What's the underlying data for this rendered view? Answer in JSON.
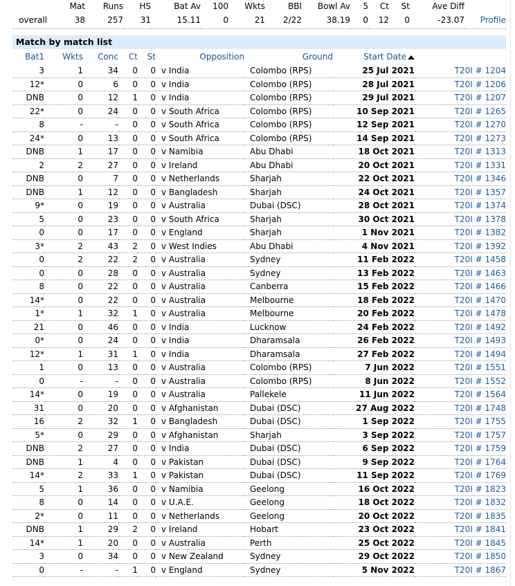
{
  "summary": {
    "headers": [
      "",
      "Mat",
      "Runs",
      "HS",
      "Bat Av",
      "100",
      "Wkts",
      "BBI",
      "Bowl Av",
      "5",
      "Ct",
      "St",
      "Ave Diff",
      ""
    ],
    "row": [
      "overall",
      "38",
      "257",
      "31",
      "15.11",
      "0",
      "21",
      "2/22",
      "38.19",
      "0",
      "12",
      "0",
      "-23.07",
      "Profile"
    ]
  },
  "section_title": "Match by match list",
  "columns": [
    "Bat1",
    "Wkts",
    "Conc",
    "Ct",
    "St",
    "Opposition",
    "Ground",
    "Start Date",
    ""
  ],
  "sort_indicator": "ascending",
  "rows": [
    [
      "3",
      "1",
      "34",
      "0",
      "0",
      "v India",
      "Colombo (RPS)",
      "25 Jul 2021",
      "T20I # 1204"
    ],
    [
      "12*",
      "0",
      "6",
      "0",
      "0",
      "v India",
      "Colombo (RPS)",
      "28 Jul 2021",
      "T20I # 1206"
    ],
    [
      "DNB",
      "0",
      "12",
      "1",
      "0",
      "v India",
      "Colombo (RPS)",
      "29 Jul 2021",
      "T20I # 1207"
    ],
    [
      "22*",
      "0",
      "24",
      "0",
      "0",
      "v South Africa",
      "Colombo (RPS)",
      "10 Sep 2021",
      "T20I # 1265"
    ],
    [
      "8",
      "-",
      "-",
      "0",
      "0",
      "v South Africa",
      "Colombo (RPS)",
      "12 Sep 2021",
      "T20I # 1270"
    ],
    [
      "24*",
      "0",
      "13",
      "0",
      "0",
      "v South Africa",
      "Colombo (RPS)",
      "14 Sep 2021",
      "T20I # 1273"
    ],
    [
      "DNB",
      "1",
      "17",
      "0",
      "0",
      "v Namibia",
      "Abu Dhabi",
      "18 Oct 2021",
      "T20I # 1313"
    ],
    [
      "2",
      "2",
      "27",
      "0",
      "0",
      "v Ireland",
      "Abu Dhabi",
      "20 Oct 2021",
      "T20I # 1331"
    ],
    [
      "DNB",
      "0",
      "7",
      "0",
      "0",
      "v Netherlands",
      "Sharjah",
      "22 Oct 2021",
      "T20I # 1346"
    ],
    [
      "DNB",
      "1",
      "12",
      "0",
      "0",
      "v Bangladesh",
      "Sharjah",
      "24 Oct 2021",
      "T20I # 1357"
    ],
    [
      "9*",
      "0",
      "19",
      "0",
      "0",
      "v Australia",
      "Dubai (DSC)",
      "28 Oct 2021",
      "T20I # 1374"
    ],
    [
      "5",
      "0",
      "23",
      "0",
      "0",
      "v South Africa",
      "Sharjah",
      "30 Oct 2021",
      "T20I # 1378"
    ],
    [
      "0",
      "0",
      "17",
      "0",
      "0",
      "v England",
      "Sharjah",
      "1 Nov 2021",
      "T20I # 1382"
    ],
    [
      "3*",
      "2",
      "43",
      "2",
      "0",
      "v West Indies",
      "Abu Dhabi",
      "4 Nov 2021",
      "T20I # 1392"
    ],
    [
      "0",
      "2",
      "22",
      "2",
      "0",
      "v Australia",
      "Sydney",
      "11 Feb 2022",
      "T20I # 1458"
    ],
    [
      "0",
      "0",
      "28",
      "0",
      "0",
      "v Australia",
      "Sydney",
      "13 Feb 2022",
      "T20I # 1463"
    ],
    [
      "8",
      "0",
      "22",
      "0",
      "0",
      "v Australia",
      "Canberra",
      "15 Feb 2022",
      "T20I # 1466"
    ],
    [
      "14*",
      "0",
      "22",
      "0",
      "0",
      "v Australia",
      "Melbourne",
      "18 Feb 2022",
      "T20I # 1470"
    ],
    [
      "1*",
      "1",
      "32",
      "1",
      "0",
      "v Australia",
      "Melbourne",
      "20 Feb 2022",
      "T20I # 1478"
    ],
    [
      "21",
      "0",
      "46",
      "0",
      "0",
      "v India",
      "Lucknow",
      "24 Feb 2022",
      "T20I # 1492"
    ],
    [
      "0*",
      "0",
      "24",
      "0",
      "0",
      "v India",
      "Dharamsala",
      "26 Feb 2022",
      "T20I # 1493"
    ],
    [
      "12*",
      "1",
      "31",
      "1",
      "0",
      "v India",
      "Dharamsala",
      "27 Feb 2022",
      "T20I # 1494"
    ],
    [
      "1",
      "0",
      "13",
      "0",
      "0",
      "v Australia",
      "Colombo (RPS)",
      "7 Jun 2022",
      "T20I # 1551"
    ],
    [
      "0",
      "-",
      "-",
      "0",
      "0",
      "v Australia",
      "Colombo (RPS)",
      "8 Jun 2022",
      "T20I # 1552"
    ],
    [
      "14*",
      "0",
      "19",
      "0",
      "0",
      "v Australia",
      "Pallekele",
      "11 Jun 2022",
      "T20I # 1564"
    ],
    [
      "31",
      "0",
      "20",
      "0",
      "0",
      "v Afghanistan",
      "Dubai (DSC)",
      "27 Aug 2022",
      "T20I # 1748"
    ],
    [
      "16",
      "2",
      "32",
      "1",
      "0",
      "v Bangladesh",
      "Dubai (DSC)",
      "1 Sep 2022",
      "T20I # 1755"
    ],
    [
      "5*",
      "0",
      "29",
      "0",
      "0",
      "v Afghanistan",
      "Sharjah",
      "3 Sep 2022",
      "T20I # 1757"
    ],
    [
      "DNB",
      "2",
      "27",
      "0",
      "0",
      "v India",
      "Dubai (DSC)",
      "6 Sep 2022",
      "T20I # 1759"
    ],
    [
      "DNB",
      "1",
      "4",
      "0",
      "0",
      "v Pakistan",
      "Dubai (DSC)",
      "9 Sep 2022",
      "T20I # 1764"
    ],
    [
      "14*",
      "2",
      "33",
      "1",
      "0",
      "v Pakistan",
      "Dubai (DSC)",
      "11 Sep 2022",
      "T20I # 1769"
    ],
    [
      "5",
      "1",
      "36",
      "0",
      "0",
      "v Namibia",
      "Geelong",
      "16 Oct 2022",
      "T20I # 1823"
    ],
    [
      "8",
      "0",
      "14",
      "0",
      "0",
      "v U.A.E.",
      "Geelong",
      "18 Oct 2022",
      "T20I # 1832"
    ],
    [
      "2*",
      "0",
      "11",
      "0",
      "0",
      "v Netherlands",
      "Geelong",
      "20 Oct 2022",
      "T20I # 1835"
    ],
    [
      "DNB",
      "1",
      "29",
      "2",
      "0",
      "v Ireland",
      "Hobart",
      "23 Oct 2022",
      "T20I # 1841"
    ],
    [
      "14*",
      "1",
      "20",
      "0",
      "0",
      "v Australia",
      "Perth",
      "25 Oct 2022",
      "T20I # 1845"
    ],
    [
      "3",
      "0",
      "34",
      "0",
      "0",
      "v New Zealand",
      "Sydney",
      "29 Oct 2022",
      "T20I # 1850"
    ],
    [
      "0",
      "-",
      "-",
      "1",
      "0",
      "v England",
      "Sydney",
      "5 Nov 2022",
      "T20I # 1867"
    ]
  ],
  "colors": {
    "section_bg": "#dcecfa",
    "link": "#1f5a9e"
  }
}
